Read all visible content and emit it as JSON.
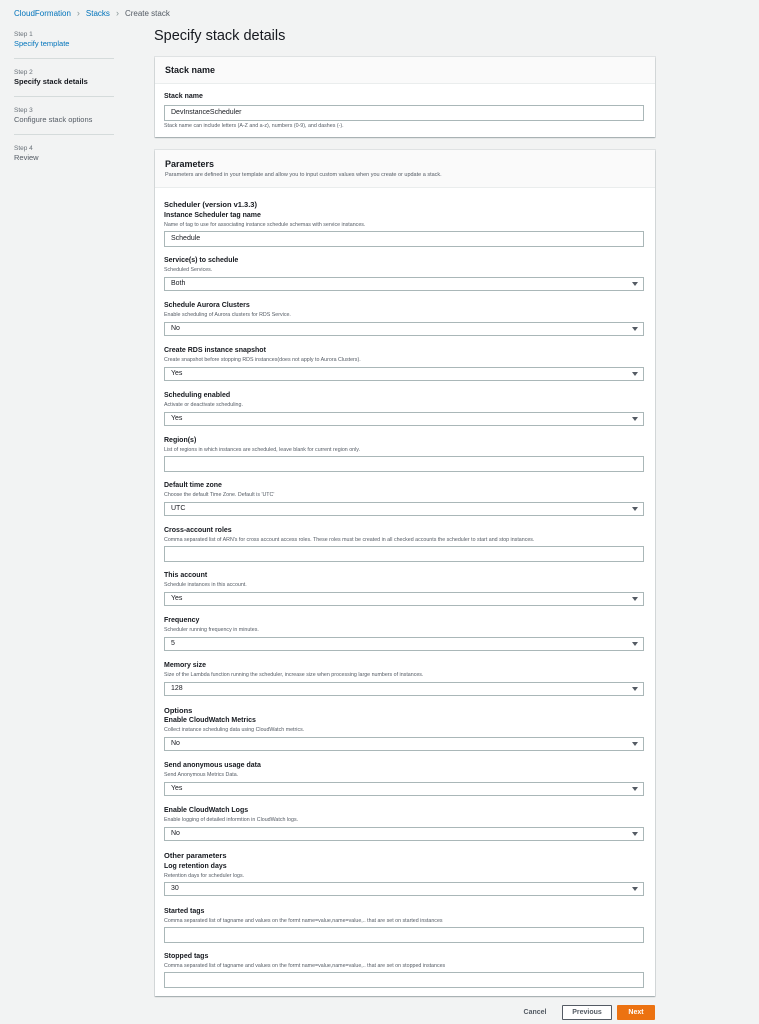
{
  "breadcrumb": {
    "root": "CloudFormation",
    "stacks": "Stacks",
    "current": "Create stack"
  },
  "steps": [
    {
      "num": "Step 1",
      "title": "Specify template"
    },
    {
      "num": "Step 2",
      "title": "Specify stack details"
    },
    {
      "num": "Step 3",
      "title": "Configure stack options"
    },
    {
      "num": "Step 4",
      "title": "Review"
    }
  ],
  "page_title": "Specify stack details",
  "stack_name": {
    "header": "Stack name",
    "label": "Stack name",
    "value": "DevInstanceScheduler",
    "hint": "Stack name can include letters (A-Z and a-z), numbers (0-9), and dashes (-)."
  },
  "parameters": {
    "header": "Parameters",
    "desc": "Parameters are defined in your template and allow you to input custom values when you create or update a stack.",
    "scheduler_section": "Scheduler (version v1.3.3)",
    "options_section": "Options",
    "other_section": "Other parameters",
    "fields": [
      {
        "label": "Instance Scheduler tag name",
        "hint": "Name of tag to use for associating instance schedule schemas with service instances.",
        "value": "Schedule"
      },
      {
        "label": "Service(s) to schedule",
        "hint": "Scheduled Services.",
        "value": "Both"
      },
      {
        "label": "Schedule Aurora Clusters",
        "hint": "Enable scheduling of Aurora clusters for RDS Service.",
        "value": "No"
      },
      {
        "label": "Create RDS instance snapshot",
        "hint": "Create snapshot before stopping RDS instances(does not apply to Aurora Clusters).",
        "value": "Yes"
      },
      {
        "label": "Scheduling enabled",
        "hint": "Activate or deactivate scheduling.",
        "value": "Yes"
      },
      {
        "label": "Region(s)",
        "hint": "List of regions in which instances are scheduled, leave blank for current region only.",
        "value": ""
      },
      {
        "label": "Default time zone",
        "hint": "Choose the default Time Zone. Default is 'UTC'",
        "value": "UTC"
      },
      {
        "label": "Cross-account roles",
        "hint": "Comma separated list of ARN's for cross account access roles. These roles must be created in all checked accounts the scheduler to start and stop instances.",
        "value": ""
      },
      {
        "label": "This account",
        "hint": "Schedule instances in this account.",
        "value": "Yes"
      },
      {
        "label": "Frequency",
        "hint": "Scheduler running frequency in minutes.",
        "value": "5"
      },
      {
        "label": "Memory size",
        "hint": "Size of the Lambda function running the scheduler, increase size when processing large numbers of instances.",
        "value": "128"
      },
      {
        "label": "Enable CloudWatch Metrics",
        "hint": "Collect instance scheduling data using CloudWatch metrics.",
        "value": "No"
      },
      {
        "label": "Send anonymous usage data",
        "hint": "Send Anonymous Metrics Data.",
        "value": "Yes"
      },
      {
        "label": "Enable CloudWatch Logs",
        "hint": "Enable logging of detailed informtion in CloudWatch logs.",
        "value": "No"
      },
      {
        "label": "Log retention days",
        "hint": "Retention days for scheduler logs.",
        "value": "30"
      },
      {
        "label": "Started tags",
        "hint": "Comma separated list of tagname and values on the formt name=value,name=value,.. that are set on started instances",
        "value": ""
      },
      {
        "label": "Stopped tags",
        "hint": "Comma separated list of tagname and values on the formt name=value,name=value,.. that are set on stopped instances",
        "value": ""
      }
    ]
  },
  "footer": {
    "cancel": "Cancel",
    "previous": "Previous",
    "next": "Next"
  },
  "colors": {
    "link": "#0073bb",
    "primary": "#ec7211",
    "background": "#f2f3f3"
  }
}
